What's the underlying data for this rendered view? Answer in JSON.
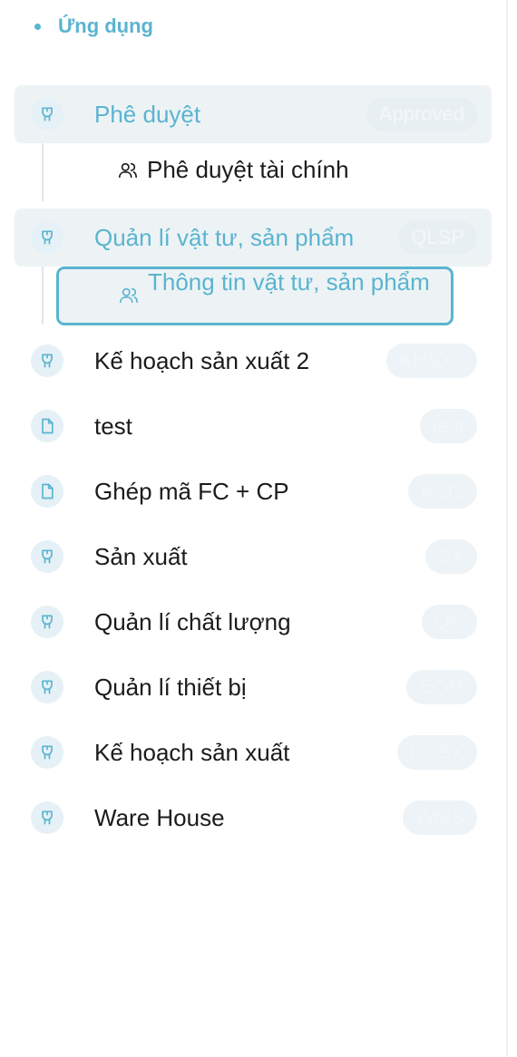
{
  "section": {
    "title": "Ứng dụng"
  },
  "apps": [
    {
      "label": "Phê duyệt",
      "code": "Approved",
      "icon": "gift-icon"
    },
    {
      "label": "Quản lí vật tư, sản phẩm",
      "code": "QLSP",
      "icon": "gift-icon"
    },
    {
      "label": "Kế hoạch sản xuất 2",
      "code": "KHSX2",
      "icon": "gift-icon"
    },
    {
      "label": "test",
      "code": "test",
      "icon": "file-icon"
    },
    {
      "label": "Ghép mã FC + CP",
      "code": "test2",
      "icon": "file-icon"
    },
    {
      "label": "Sản xuất",
      "code": "SX",
      "icon": "gift-icon"
    },
    {
      "label": "Quản lí chất lượng",
      "code": "QC",
      "icon": "gift-icon"
    },
    {
      "label": "Quản lí thiết bị",
      "code": "EQM",
      "icon": "gift-icon"
    },
    {
      "label": "Kế hoạch sản xuất",
      "code": "KHSX",
      "icon": "gift-icon"
    },
    {
      "label": "Ware House",
      "code": "WMS",
      "icon": "gift-icon"
    }
  ],
  "sub_items": [
    {
      "label": "Phê duyệt tài chính",
      "icon": "users-icon"
    },
    {
      "label": "Thông tin vật tư, sản phẩm",
      "icon": "users-icon"
    }
  ],
  "colors": {
    "accent": "#5ab4d0",
    "active_bg": "#edf3f5",
    "text": "#1b1b1b"
  }
}
